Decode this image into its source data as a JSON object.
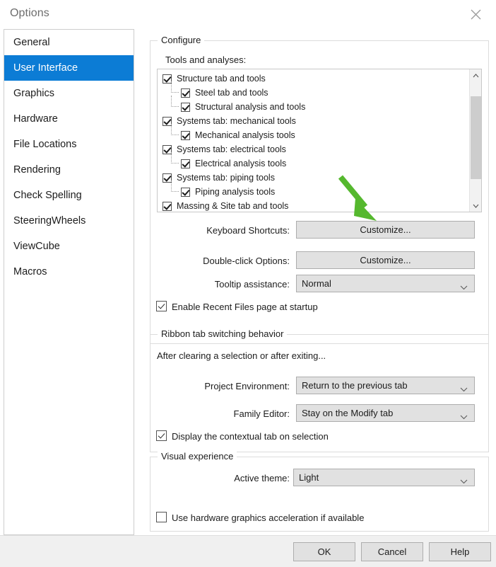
{
  "window": {
    "title": "Options",
    "close_icon": "close-icon"
  },
  "sidebar": {
    "items": [
      {
        "label": "General",
        "selected": false
      },
      {
        "label": "User Interface",
        "selected": true
      },
      {
        "label": "Graphics",
        "selected": false
      },
      {
        "label": "Hardware",
        "selected": false
      },
      {
        "label": "File Locations",
        "selected": false
      },
      {
        "label": "Rendering",
        "selected": false
      },
      {
        "label": "Check Spelling",
        "selected": false
      },
      {
        "label": "SteeringWheels",
        "selected": false
      },
      {
        "label": "ViewCube",
        "selected": false
      },
      {
        "label": "Macros",
        "selected": false
      }
    ]
  },
  "configure": {
    "legend": "Configure",
    "tools_label": "Tools and analyses:",
    "tree": [
      {
        "label": "Structure tab and tools",
        "level": 0,
        "checked": true
      },
      {
        "label": "Steel tab and tools",
        "level": 1,
        "checked": true
      },
      {
        "label": "Structural analysis and tools",
        "level": 1,
        "checked": true
      },
      {
        "label": "Systems tab: mechanical tools",
        "level": 0,
        "checked": true
      },
      {
        "label": "Mechanical analysis tools",
        "level": 1,
        "checked": true
      },
      {
        "label": "Systems tab: electrical tools",
        "level": 0,
        "checked": true
      },
      {
        "label": "Electrical analysis tools",
        "level": 1,
        "checked": true
      },
      {
        "label": "Systems tab: piping tools",
        "level": 0,
        "checked": true
      },
      {
        "label": "Piping analysis tools",
        "level": 1,
        "checked": true
      },
      {
        "label": "Massing & Site tab and tools",
        "level": 0,
        "checked": true
      }
    ],
    "keyboard_shortcuts_label": "Keyboard Shortcuts:",
    "keyboard_shortcuts_button": "Customize...",
    "double_click_label": "Double-click Options:",
    "double_click_button": "Customize...",
    "tooltip_label": "Tooltip assistance:",
    "tooltip_value": "Normal",
    "recent_files_label": "Enable Recent Files page at startup",
    "recent_files_checked": true
  },
  "ribbon": {
    "legend": "Ribbon tab switching behavior",
    "intro": "After clearing a selection or after exiting...",
    "project_env_label": "Project Environment:",
    "project_env_value": "Return to the previous tab",
    "family_editor_label": "Family Editor:",
    "family_editor_value": "Stay on the Modify tab",
    "contextual_label": "Display the contextual tab on selection",
    "contextual_checked": true
  },
  "visual": {
    "legend": "Visual experience",
    "theme_label": "Active theme:",
    "theme_value": "Light",
    "hardware_label": "Use hardware graphics acceleration if available",
    "hardware_checked": false
  },
  "footer": {
    "ok": "OK",
    "cancel": "Cancel",
    "help": "Help"
  },
  "annotation": {
    "arrow_color": "#55b82e",
    "points_to": "Customize..."
  },
  "colors": {
    "selection_blue": "#0c7cd5",
    "button_face": "#e1e1e1",
    "button_border": "#adadad",
    "group_border": "#dcdcdc",
    "arrow_green": "#55b82e"
  }
}
